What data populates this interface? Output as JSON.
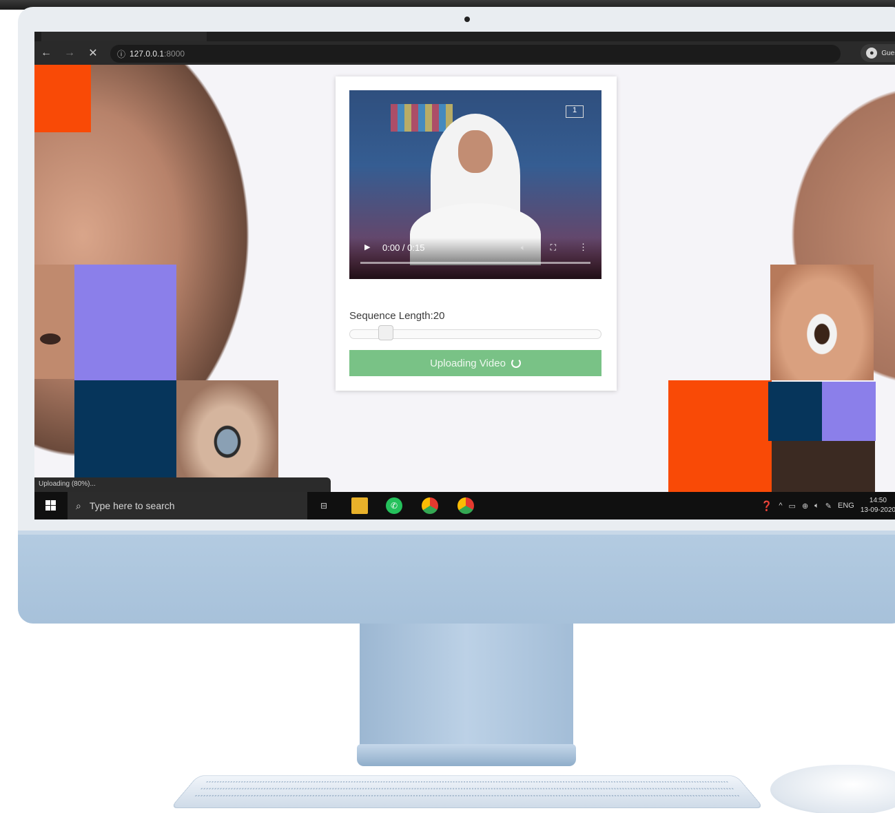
{
  "browser": {
    "url_host": "127.0.0.1",
    "url_port": ":8000",
    "profile_label": "Guest"
  },
  "video": {
    "time": "0:00 / 0:15",
    "channel_logo": "1"
  },
  "form": {
    "sequence_label": "Sequence Length:20",
    "sequence_value": 20,
    "upload_button_label": "Uploading Video"
  },
  "status_bubble": "Uploading (80%)...",
  "taskbar": {
    "search_placeholder": "Type here to search",
    "language": "ENG",
    "time": "14:50",
    "date": "13-09-2020"
  },
  "colors": {
    "accent_orange": "#f94a06",
    "accent_purple": "#8b7fea",
    "accent_navy": "#06355b",
    "upload_green": "#79c286"
  }
}
